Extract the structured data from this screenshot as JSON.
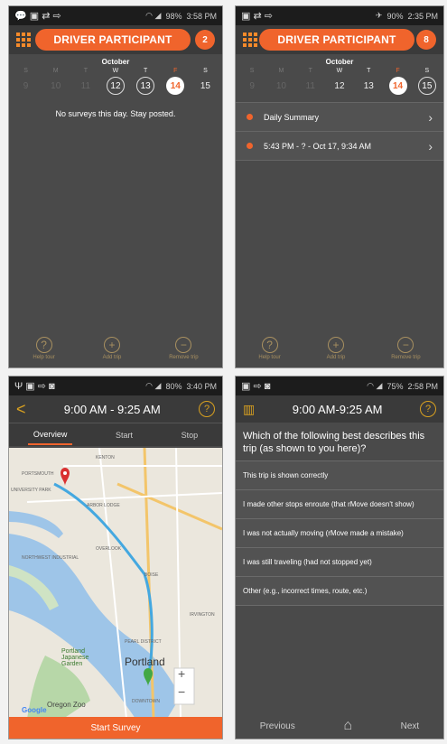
{
  "status_bars": [
    {
      "icons_left": "💬 ▣ ⇄ ⇨",
      "battery": "98%",
      "time": "3:58 PM"
    },
    {
      "icons_left": "▣ ⇄ ⇨",
      "battery": "90%",
      "time": "2:35 PM"
    },
    {
      "icons_left": "Ψ ▣ ⇨ ◙",
      "battery": "80%",
      "time": "3:40 PM"
    },
    {
      "icons_left": "▣ ⇨ ◙",
      "battery": "75%",
      "time": "2:58 PM"
    }
  ],
  "screen1": {
    "title": "DRIVER PARTICIPANT",
    "badge": "2",
    "month": "October",
    "days": [
      {
        "name": "S",
        "num": "9"
      },
      {
        "name": "M",
        "num": "10"
      },
      {
        "name": "T",
        "num": "11"
      },
      {
        "name": "W",
        "num": "12"
      },
      {
        "name": "T",
        "num": "13"
      },
      {
        "name": "F",
        "num": "14"
      },
      {
        "name": "S",
        "num": "15"
      }
    ],
    "empty_message": "No surveys this day. Stay posted.",
    "footer": {
      "help": "Help tour",
      "add": "Add trip",
      "remove": "Remove trip"
    }
  },
  "screen2": {
    "title": "DRIVER PARTICIPANT",
    "badge": "8",
    "month": "October",
    "days": [
      {
        "name": "S",
        "num": "9"
      },
      {
        "name": "M",
        "num": "10"
      },
      {
        "name": "T",
        "num": "11"
      },
      {
        "name": "W",
        "num": "12"
      },
      {
        "name": "T",
        "num": "13"
      },
      {
        "name": "F",
        "num": "14"
      },
      {
        "name": "S",
        "num": "15"
      }
    ],
    "rows": [
      "Daily Summary",
      "5:43 PM - ? - Oct 17, 9:34 AM"
    ],
    "footer": {
      "help": "Help tour",
      "add": "Add trip",
      "remove": "Remove trip"
    }
  },
  "screen3": {
    "back": "<",
    "title": "9:00 AM - 9:25 AM",
    "help": "?",
    "tabs": [
      "Overview",
      "Start",
      "Stop"
    ],
    "map_labels": [
      "PORTSMOUTH",
      "UNIVERSITY PARK",
      "ARBOR LODGE",
      "OVERLOOK",
      "NORTHWEST INDUSTRIAL",
      "BOISE",
      "IRVINGTON",
      "PEARL DISTRICT",
      "Portland",
      "Portland Japanese Garden",
      "DOWNTOWN",
      "Oregon Zoo",
      "Google",
      "KENTON"
    ],
    "zoom_in": "+",
    "zoom_out": "−",
    "start_button": "Start Survey"
  },
  "screen4": {
    "title": "9:00 AM-9:25 AM",
    "help": "?",
    "question": "Which of the following best describes this trip (as shown to you here)?",
    "options": [
      "This trip is shown correctly",
      "I made other stops enroute (that rMove doesn't show)",
      "I was not actually moving (rMove made a mistake)",
      "I was still traveling (had not stopped yet)",
      "Other (e.g., incorrect times, route, etc.)"
    ],
    "previous": "Previous",
    "next": "Next"
  },
  "colors": {
    "accent": "#f0642c",
    "gold": "#d8a020",
    "panel": "#4a4a4a"
  }
}
